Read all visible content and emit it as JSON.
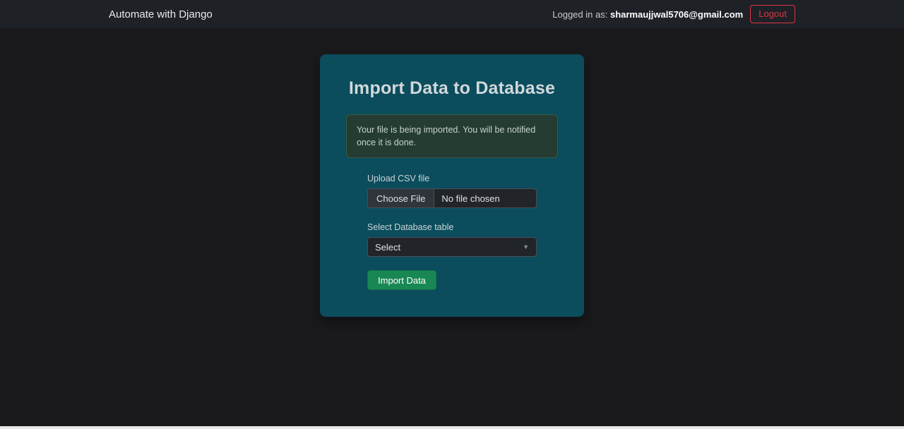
{
  "navbar": {
    "brand": "Automate with Django",
    "logged_in_label": "Logged in as:",
    "user_email": "sharmaujjwal5706@gmail.com",
    "logout_label": "Logout"
  },
  "card": {
    "title": "Import Data to Database",
    "alert_text": "Your file is being imported. You will be notified once it is done.",
    "upload_label": "Upload CSV file",
    "file_button_label": "Choose File",
    "file_status": "No file chosen",
    "select_label": "Select Database table",
    "select_value": "Select",
    "submit_label": "Import Data"
  },
  "icons": {
    "chevron_down": "▼"
  },
  "colors": {
    "navbar_bg": "#1e2126",
    "body_bg": "#1a1a1d",
    "card_bg": "#0b4d5c",
    "alert_bg": "#243c31",
    "alert_border": "#3a5a48",
    "success_green": "#198754",
    "danger_red": "#dc3545"
  }
}
